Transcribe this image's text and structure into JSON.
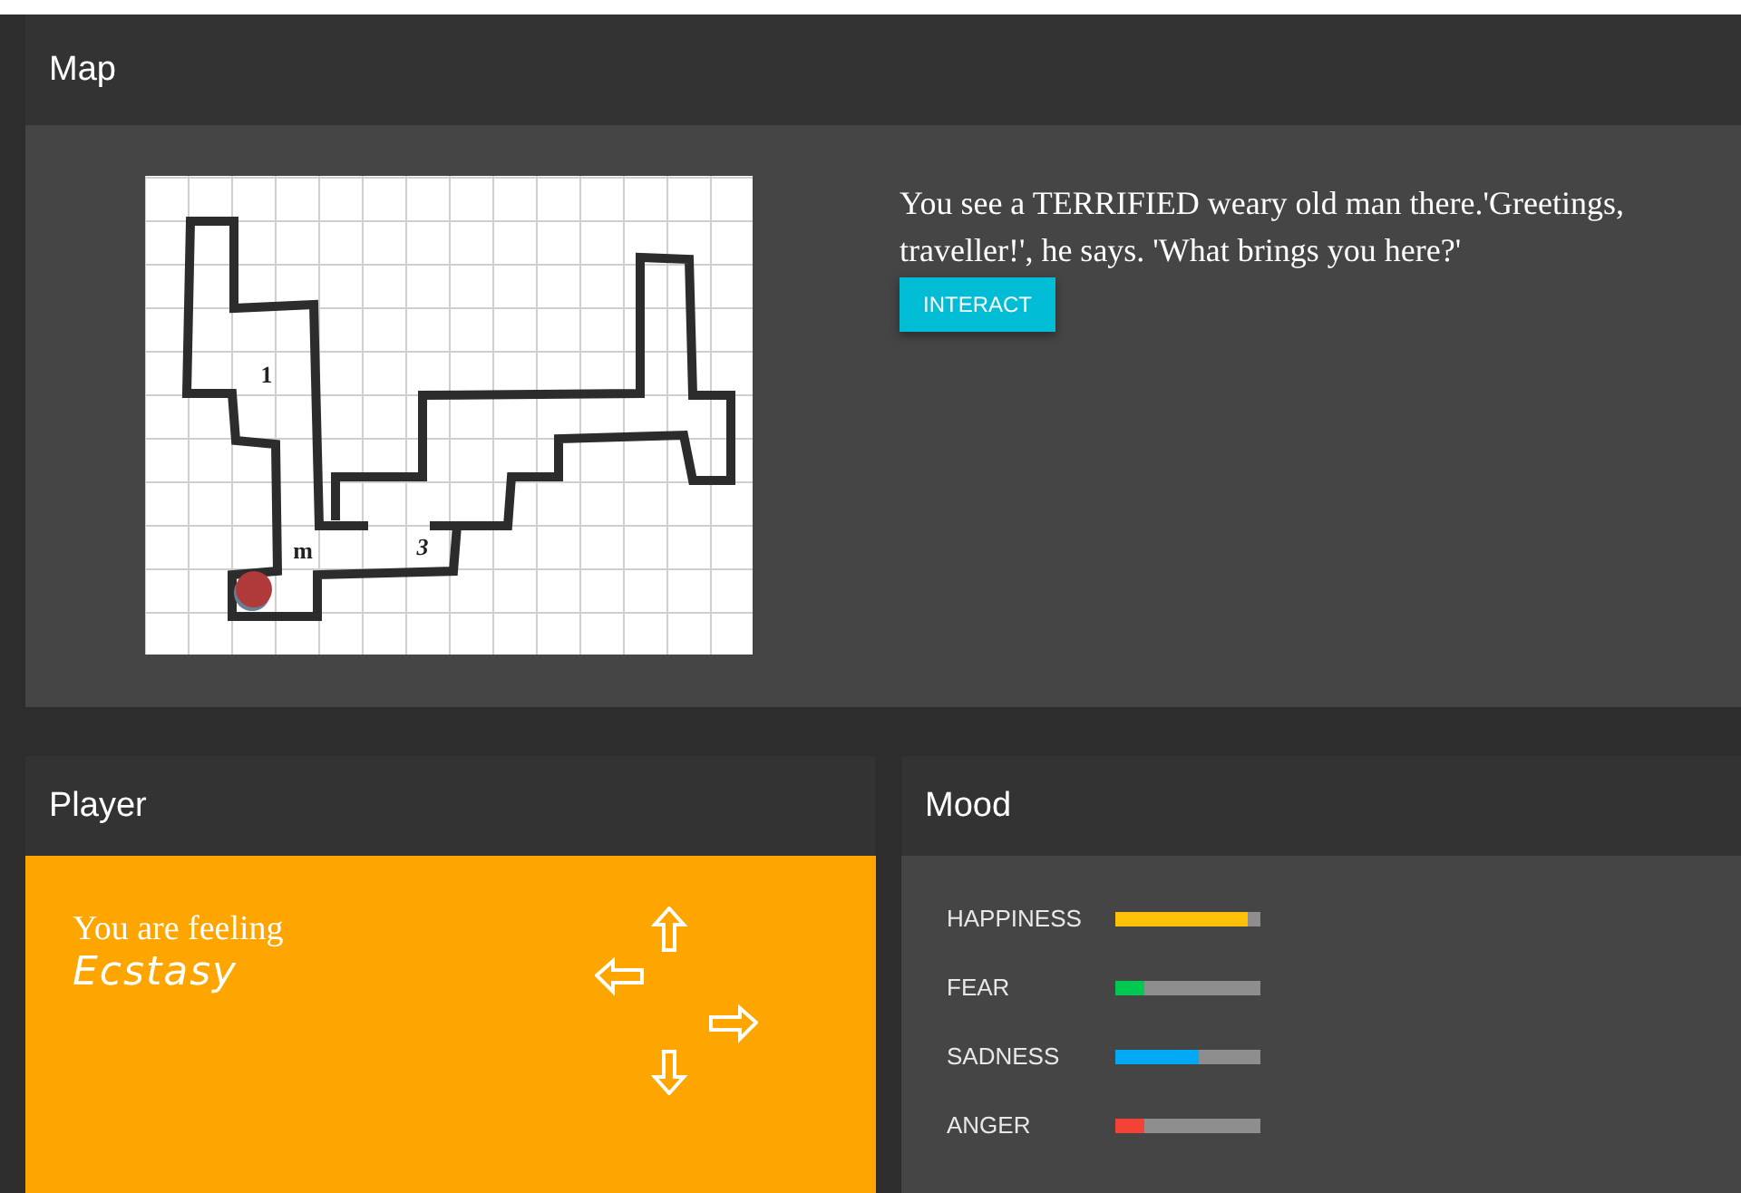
{
  "map": {
    "title": "Map",
    "labels": [
      "1",
      "m",
      "3"
    ],
    "description": "You see a TERRIFIED weary old man there.'Greetings, traveller!', he says. 'What brings you here?'",
    "action": "INTERACT"
  },
  "player": {
    "title": "Player",
    "feeling_label": "You are feeling",
    "feeling": "Ecstasy"
  },
  "mood": {
    "title": "Mood",
    "meters": [
      {
        "name": "HAPPINESS",
        "level": 0.91,
        "color": "#ffc107"
      },
      {
        "name": "FEAR",
        "level": 0.2,
        "color": "#00c853"
      },
      {
        "name": "SADNESS",
        "level": 0.57,
        "color": "#03a9f4"
      },
      {
        "name": "ANGER",
        "level": 0.2,
        "color": "#f44336"
      }
    ]
  }
}
